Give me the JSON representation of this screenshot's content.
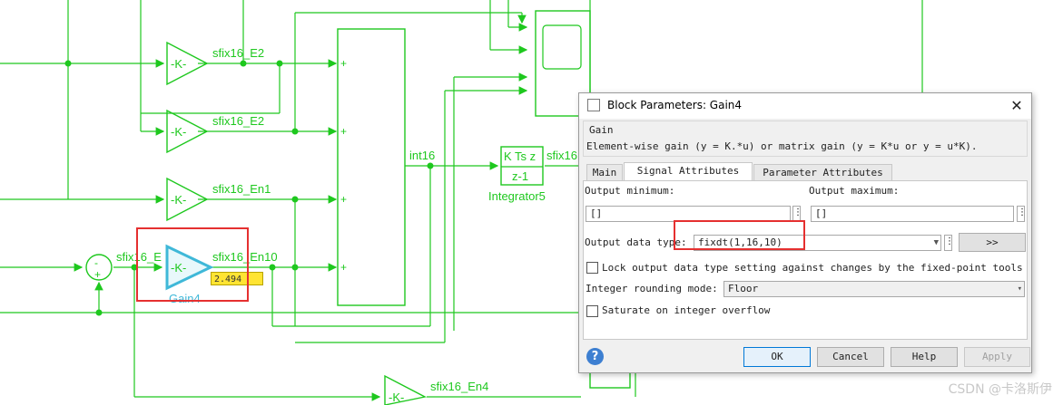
{
  "diagram": {
    "signal_labels": {
      "e2_top": "sfix16_E2",
      "e2_second": "sfix16_E2",
      "en1": "sfix16_En1",
      "en10": "sfix16_En10",
      "en_clipped": "sfix16_E",
      "int16": "int16",
      "sfix16_out": "sfix16",
      "en4": "sfix16_En4"
    },
    "gain_label": "-K-",
    "sum_minus": "-",
    "sum_plus": "+",
    "port_plus": "+",
    "integrator": {
      "top": "K Ts z",
      "bottom": "z-1",
      "name": "Integrator5"
    },
    "gain4_name": "Gain4",
    "value_tooltip": "2.494"
  },
  "dialog": {
    "title": "Block Parameters: Gain4",
    "section": "Gain",
    "description": "Element-wise gain (y = K.*u) or matrix gain (y = K*u or y = u*K).",
    "tabs": [
      "Main",
      "Signal Attributes",
      "Parameter Attributes"
    ],
    "active_tab": "Signal Attributes",
    "output_min_label": "Output minimum:",
    "output_max_label": "Output maximum:",
    "output_min_value": "[]",
    "output_max_value": "[]",
    "dots": "⋮",
    "output_dtype_label": "Output data type:",
    "output_dtype_value": "fixdt(1,16,10)",
    "assistant_button": ">>",
    "lock_label": "Lock output data type setting against changes by the fixed-point tools",
    "rounding_label": "Integer rounding mode:",
    "rounding_value": "Floor",
    "saturate_label": "Saturate on integer overflow",
    "buttons": {
      "ok": "OK",
      "cancel": "Cancel",
      "help": "Help",
      "apply": "Apply"
    },
    "help_glyph": "?"
  },
  "watermark": "CSDN @卡洛斯伊",
  "colors": {
    "signal": "#1ec81e",
    "highlight_box": "#e53030",
    "selected_block": "#3fb8d8",
    "tooltip": "#ffe433"
  }
}
